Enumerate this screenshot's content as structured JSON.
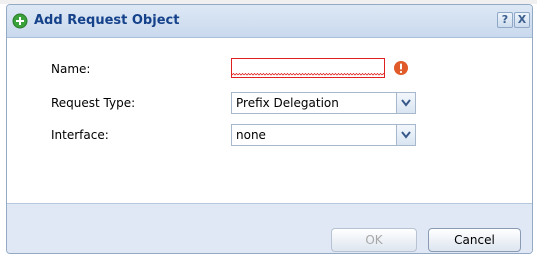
{
  "dialog": {
    "title": "Add Request Object",
    "help_label": "?",
    "close_label": "X"
  },
  "form": {
    "name": {
      "label": "Name:",
      "value": ""
    },
    "request_type": {
      "label": "Request Type:",
      "value": "Prefix Delegation"
    },
    "interface": {
      "label": "Interface:",
      "value": "none"
    }
  },
  "footer": {
    "ok_label": "OK",
    "cancel_label": "Cancel"
  },
  "colors": {
    "title_text": "#15428b",
    "error": "#e02020",
    "add_icon_green": "#3aa23a"
  }
}
